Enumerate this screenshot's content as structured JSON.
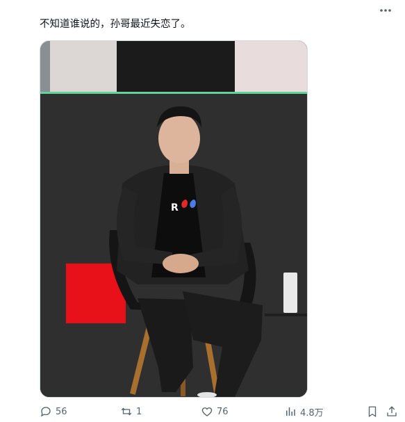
{
  "tweet": {
    "text": "不知道谁说的，孙哥最近失恋了。"
  },
  "media": {
    "shirt_logo_text": "R"
  },
  "actions": {
    "replies": "56",
    "retweets": "1",
    "likes": "76",
    "views": "4.8万"
  },
  "icons": {
    "more": "more-dots-icon",
    "reply": "reply-icon",
    "retweet": "retweet-icon",
    "like": "heart-icon",
    "views": "views-chart-icon",
    "bookmark": "bookmark-icon",
    "share": "share-icon"
  },
  "colors": {
    "text": "#0f1419",
    "secondary": "#536471",
    "border": "#cfd9de"
  }
}
